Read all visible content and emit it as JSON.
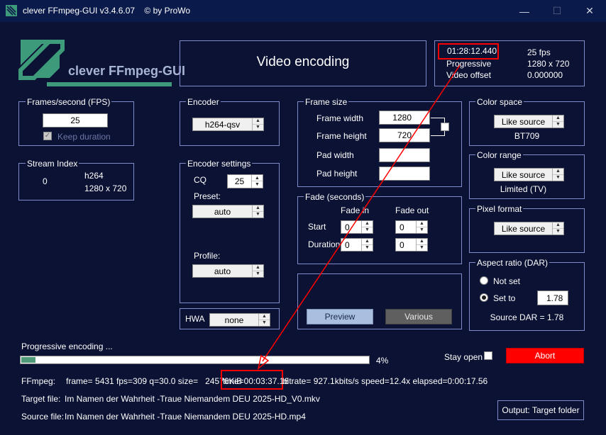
{
  "window": {
    "title": "clever FFmpeg-GUI v3.4.6.07    © by ProWo",
    "minimize": "—",
    "maximize": "☐",
    "close": "✕"
  },
  "logo": {
    "text": "clever FFmpeg-GUI"
  },
  "header": {
    "title": "Video encoding"
  },
  "info": {
    "duration": "01:28:12.440",
    "fps": "25 fps",
    "scan_type": "Progressive",
    "resolution": "1280 x 720",
    "video_offset_label": "Video offset",
    "video_offset": "0.000000"
  },
  "fps_box": {
    "title": "Frames/second (FPS)",
    "value": "25",
    "keep_duration_label": "Keep duration",
    "keep_duration_checked": true
  },
  "stream_box": {
    "title": "Stream Index",
    "index": "0",
    "codec": "h264",
    "resolution": "1280 x 720"
  },
  "encoder_box": {
    "title": "Encoder",
    "value": "h264-qsv"
  },
  "encoder_settings": {
    "title": "Encoder settings",
    "cq_label": "CQ",
    "cq_value": "25",
    "preset_label": "Preset:",
    "preset_value": "auto",
    "profile_label": "Profile:",
    "profile_value": "auto"
  },
  "hwa": {
    "label": "HWA",
    "value": "none"
  },
  "frame_size": {
    "title": "Frame size",
    "width_label": "Frame width",
    "width_value": "1280",
    "height_label": "Frame height",
    "height_value": "720",
    "pad_width_label": "Pad width",
    "pad_width_value": "",
    "pad_height_label": "Pad height",
    "pad_height_value": ""
  },
  "fade": {
    "title": "Fade (seconds)",
    "fade_in_label": "Fade in",
    "fade_out_label": "Fade out",
    "start_label": "Start",
    "duration_label": "Duration",
    "start_in": "0",
    "start_out": "0",
    "duration_in": "0",
    "duration_out": "0"
  },
  "actions": {
    "preview_label": "Preview",
    "various_label": "Various"
  },
  "color_space": {
    "title": "Color space",
    "value": "Like source",
    "info": "BT709"
  },
  "color_range": {
    "title": "Color range",
    "value": "Like source",
    "info": "Limited (TV)"
  },
  "pixel_format": {
    "title": "Pixel format",
    "value": "Like source"
  },
  "aspect": {
    "title": "Aspect ratio (DAR)",
    "not_set_label": "Not set",
    "set_to_label": "Set to",
    "set_to_value": "1.78",
    "source_dar": "Source DAR = 1.78",
    "selected": "set_to"
  },
  "progress": {
    "label": "Progressive encoding ...",
    "percent_text": "4%",
    "fraction": 0.04
  },
  "stay_open": {
    "label": "Stay open",
    "checked": false
  },
  "abort": {
    "label": "Abort"
  },
  "log": {
    "ffmpeg_label": "FFmpeg:",
    "ffmpeg_stats_before": "frame= 5431 fps=309 q=30.0 size=   24576KiB",
    "ffmpeg_time": "time=00:03:37.16",
    "ffmpeg_stats_after": "bitrate= 927.1kbits/s speed=12.4x elapsed=0:00:17.56",
    "target_label": "Target file:",
    "target_value": "Im Namen der Wahrheit -Traue Niemandem DEU 2025-HD_V0.mkv",
    "source_label": "Source file:",
    "source_value": "Im Namen der Wahrheit -Traue Niemandem DEU 2025-HD.mp4"
  },
  "output_button": {
    "label": "Output: Target folder"
  },
  "colors": {
    "background": "#0b1233",
    "accent_red": "#ff0000",
    "preview_button": "#a9bfe0",
    "various_button": "#5f5f5f",
    "progress_fill": "#4f9b78",
    "logo_green": "#3d9a7a"
  }
}
